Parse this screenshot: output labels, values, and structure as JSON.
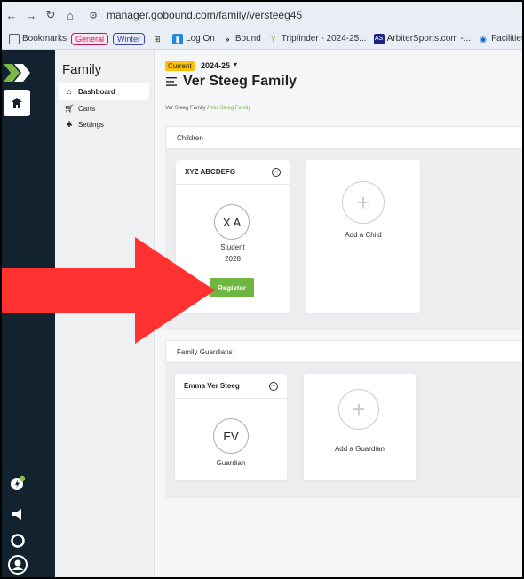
{
  "browser": {
    "url": "manager.gobound.com/family/versteeg45",
    "bookmarks": [
      {
        "label": "Bookmarks",
        "icon": "folder-icon"
      },
      {
        "label": "General",
        "type": "chip",
        "color": "#c2185b"
      },
      {
        "label": "Winter",
        "type": "chip",
        "color": "#3949ab"
      },
      {
        "label": "",
        "icon": "grid-icon"
      },
      {
        "label": "Log On",
        "icon": "logon-icon"
      },
      {
        "label": "Bound",
        "icon": "bound-icon"
      },
      {
        "label": "Tripfinder - 2024-25...",
        "icon": "tripfinder-icon"
      },
      {
        "label": "ArbiterSports.com -...",
        "icon": "arbiter-icon"
      },
      {
        "label": "Facilities Schedule",
        "icon": "facilities-icon"
      }
    ]
  },
  "sidenav": {
    "title": "Family",
    "items": [
      {
        "label": "Dashboard",
        "icon": "home-icon",
        "active": true
      },
      {
        "label": "Carts",
        "icon": "cart-icon",
        "active": false
      },
      {
        "label": "Settings",
        "icon": "gear-icon",
        "active": false
      }
    ]
  },
  "header": {
    "season_badge": "Current",
    "season_year": "2024-25",
    "title": "Ver Steeg Family",
    "breadcrumb": {
      "root": "Ver Steeg Family",
      "sep": "/",
      "current": "Ver Steeg Family"
    }
  },
  "children": {
    "section_title": "Children",
    "child": {
      "name": "XYZ ABCDEFG",
      "initials": "X A",
      "role": "Student",
      "year": "2028",
      "register_label": "Register"
    },
    "add_label": "Add a Child"
  },
  "guardians": {
    "section_title": "Family Guardians",
    "guardian": {
      "name": "Emma Ver Steeg",
      "initials": "EV",
      "role": "Guardian"
    },
    "add_label": "Add a Guardian"
  },
  "colors": {
    "accent_green": "#6fb541",
    "season_yellow": "#ffc107",
    "rail_dark": "#13222f",
    "annotation_arrow": "#ff3131"
  }
}
